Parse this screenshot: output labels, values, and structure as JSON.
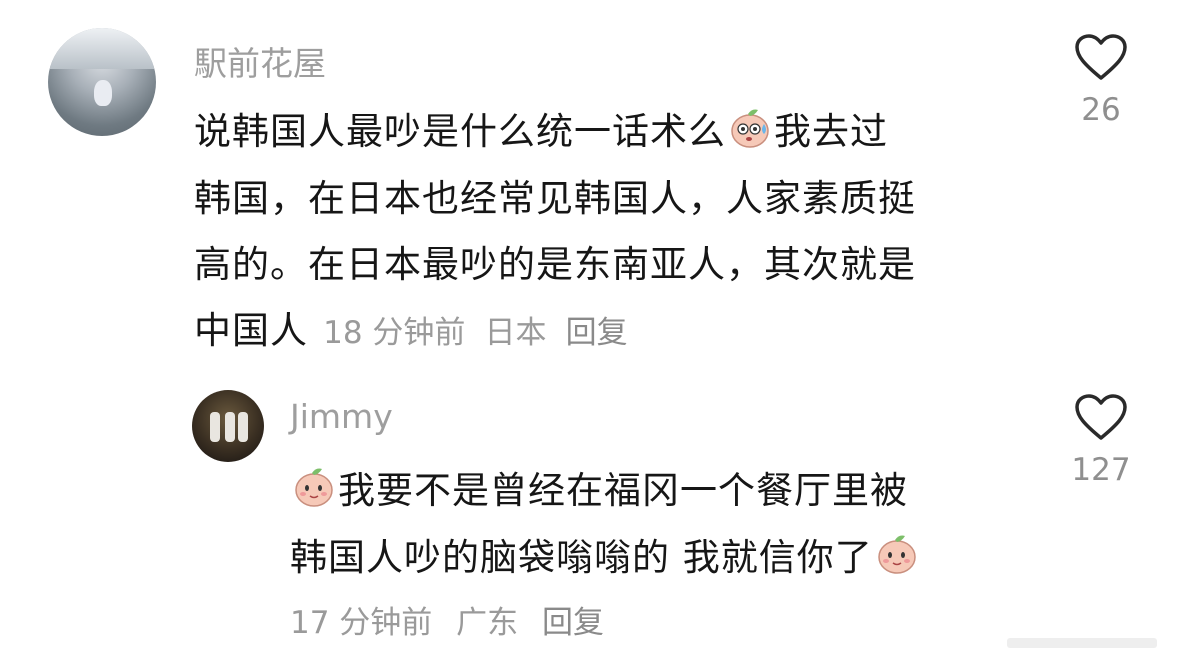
{
  "comments": [
    {
      "username": "駅前花屋",
      "lines": [
        "说韩国人最吵是什么统一话术么",
        "我去过",
        "韩国，在日本也经常见韩国人，人家素质挺",
        "高的。在日本最吵的是东南亚人，其次就是",
        "中国人"
      ],
      "time": "18 分钟前",
      "location": "日本",
      "reply_label": "回复",
      "likes": "26",
      "emoji_inline": "sweat-peach-emoji"
    },
    {
      "username": "Jimmy",
      "lines": [
        "我要不是曾经在福冈一个餐厅里被",
        "韩国人吵的脑袋嗡嗡的 我就信你了"
      ],
      "time": "17 分钟前",
      "location": "广东",
      "reply_label": "回复",
      "likes": "127",
      "emoji_inline": "peach-face-emoji"
    }
  ],
  "colors": {
    "text": "#161616",
    "meta": "#9a9a9a",
    "name": "#9e9e9e",
    "heart_stroke": "#2a2a2a"
  }
}
